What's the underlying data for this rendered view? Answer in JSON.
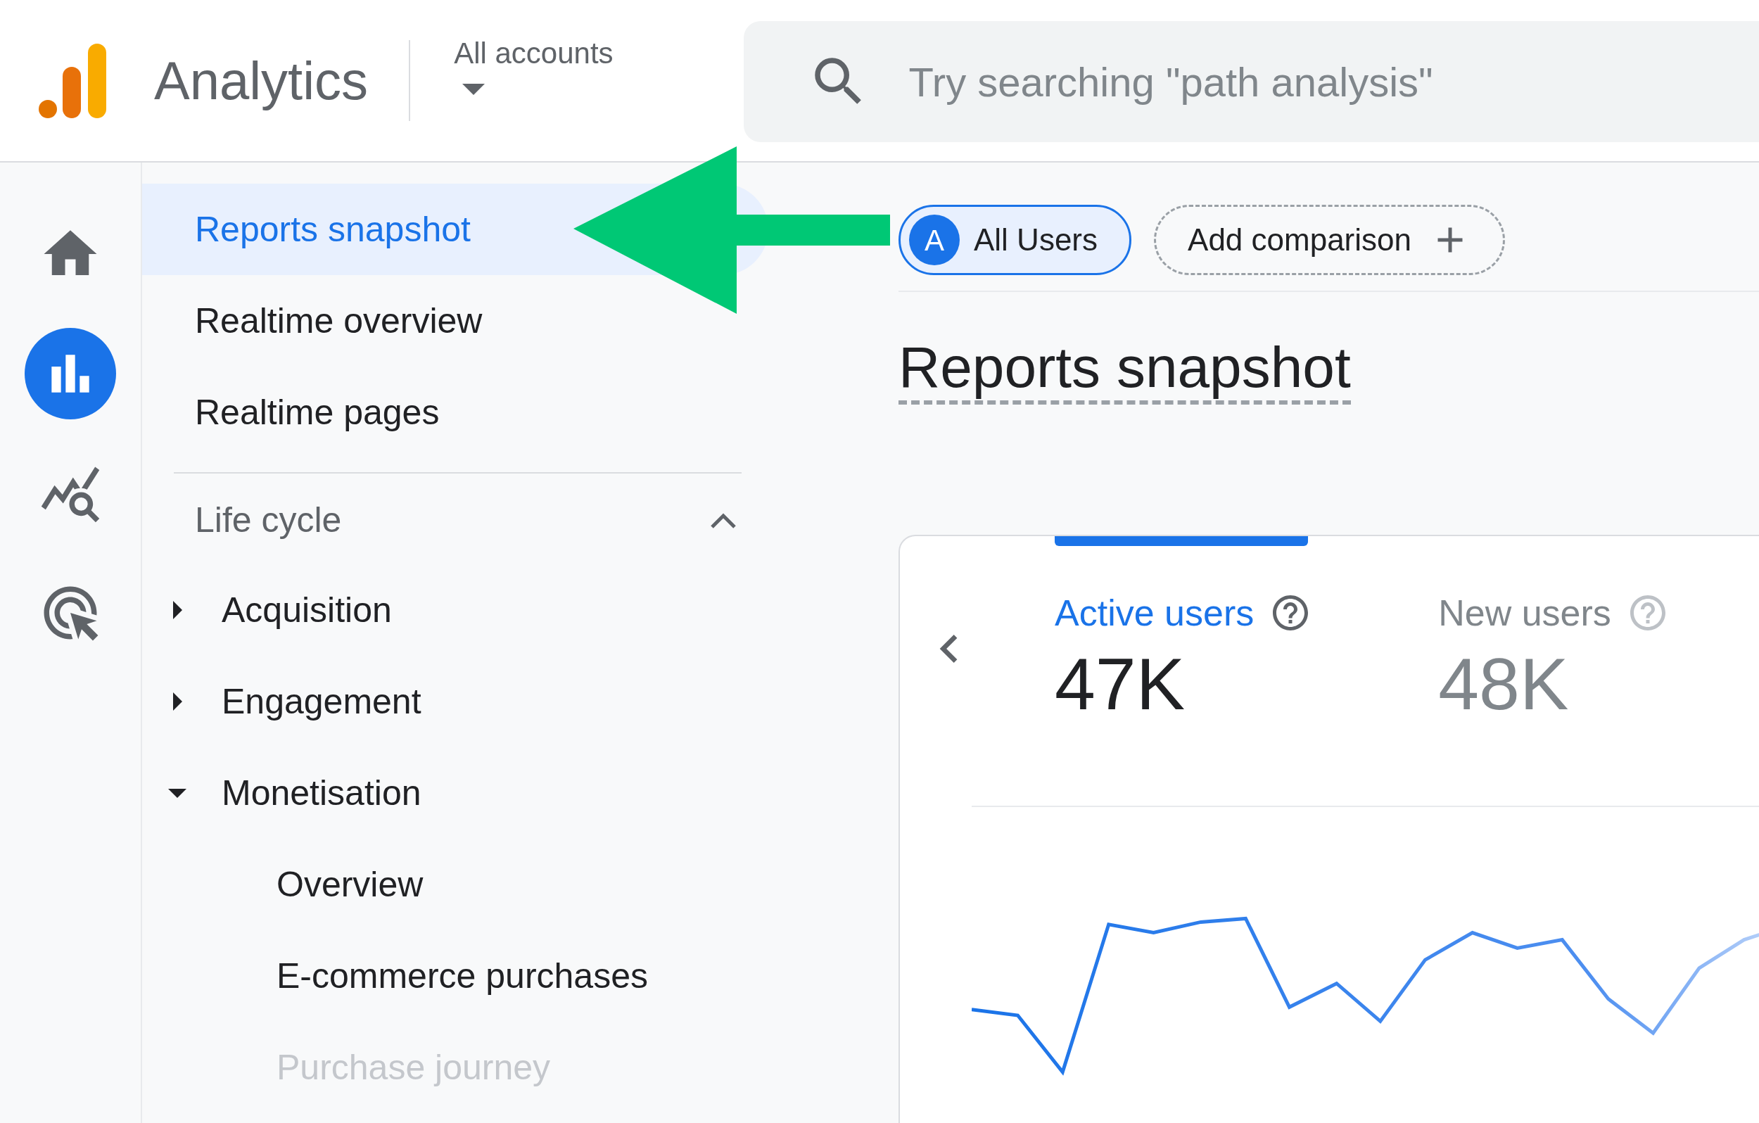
{
  "header": {
    "product": "Analytics",
    "account_picker": "All accounts",
    "search": {
      "placeholder": "Try searching \"path analysis\""
    }
  },
  "rail": [
    {
      "kind": "home",
      "selected": false
    },
    {
      "kind": "reports",
      "selected": true
    },
    {
      "kind": "explore",
      "selected": false
    },
    {
      "kind": "advertising",
      "selected": false
    }
  ],
  "nav": {
    "items": [
      {
        "label": "Reports snapshot",
        "selected": true
      },
      {
        "label": "Realtime overview",
        "selected": false
      },
      {
        "label": "Realtime pages",
        "selected": false
      }
    ],
    "section": {
      "title": "Life cycle",
      "expanded": true,
      "children": [
        {
          "label": "Acquisition",
          "expanded": false
        },
        {
          "label": "Engagement",
          "expanded": false
        },
        {
          "label": "Monetisation",
          "expanded": true,
          "children": [
            {
              "label": "Overview",
              "faded": false
            },
            {
              "label": "E-commerce purchases",
              "faded": false
            },
            {
              "label": "Purchase journey",
              "faded": true
            }
          ]
        }
      ]
    }
  },
  "main": {
    "segment": {
      "badge": "A",
      "label": "All Users"
    },
    "add_comparison": "Add comparison",
    "title": "Reports snapshot",
    "metrics": [
      {
        "label": "Active users",
        "value": "47K",
        "selected": true
      },
      {
        "label": "New users",
        "value": "48K",
        "selected": false
      }
    ]
  },
  "annotation": {
    "kind": "arrow",
    "color": "#00c875"
  }
}
